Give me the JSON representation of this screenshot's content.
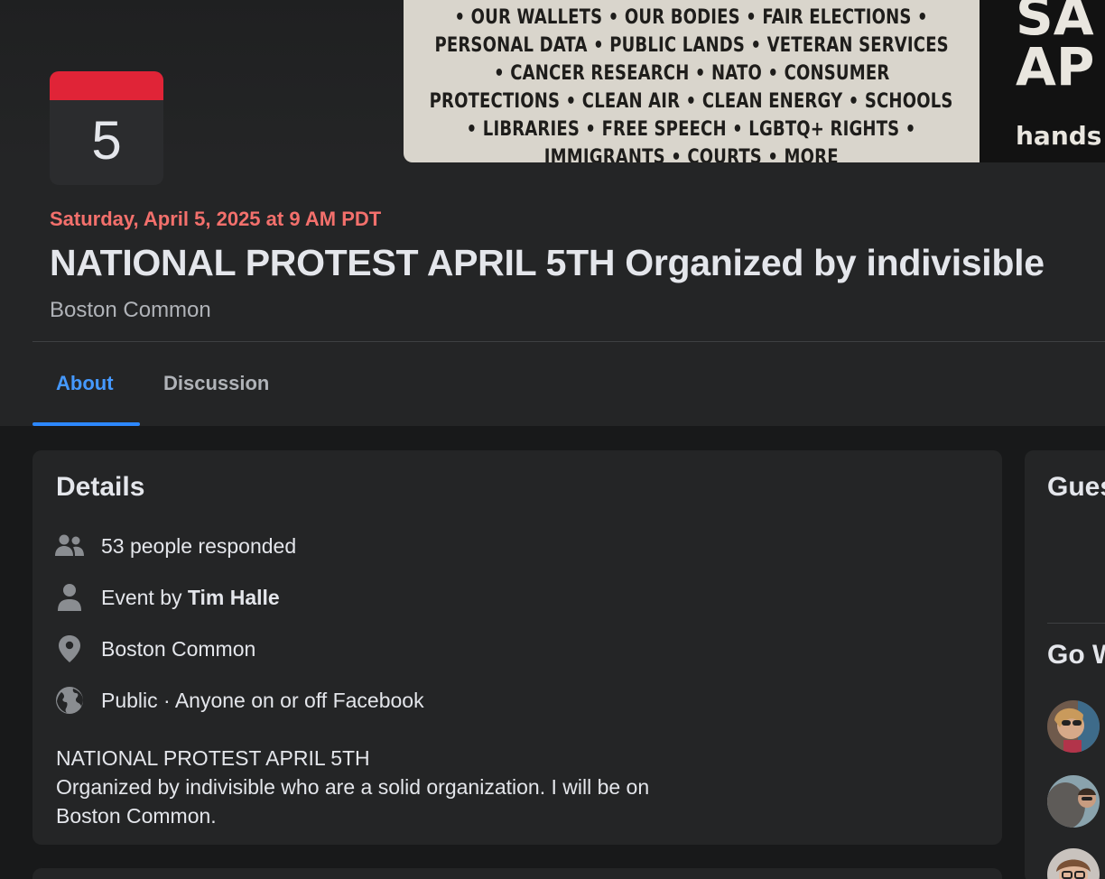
{
  "cover": {
    "lines": [
      "• OUR WALLETS • OUR BODIES • FAIR ELECTIONS •",
      "PERSONAL DATA • PUBLIC LANDS • VETERAN SERVICES",
      "• CANCER RESEARCH • NATO • CONSUMER",
      "PROTECTIONS • CLEAN AIR • CLEAN ENERGY • SCHOOLS",
      "• LIBRARIES • FREE SPEECH • LGBTQ+ RIGHTS •",
      "IMMIGRANTS • COURTS • MORE"
    ],
    "big_1": "SA",
    "big_2": "AP",
    "small": "hands"
  },
  "calendar": {
    "day": "5",
    "accent_color": "#e02437"
  },
  "event": {
    "date": "Saturday, April 5, 2025 at 9 AM PDT",
    "title": "NATIONAL PROTEST APRIL 5TH Organized by indivisible",
    "location": "Boston Common"
  },
  "tabs": [
    {
      "label": "About",
      "active": true
    },
    {
      "label": "Discussion",
      "active": false
    }
  ],
  "details": {
    "title": "Details",
    "responded": "53 people responded",
    "event_by_prefix": "Event by",
    "host": "Tim Halle",
    "place": "Boston Common",
    "privacy": "Public · Anyone on or off Facebook",
    "description_line1": "NATIONAL PROTEST APRIL 5TH",
    "description_line2": "Organized by indivisible who are a solid organization. I will be on Boston Common."
  },
  "sidebar": {
    "guests_title": "Gues",
    "going_title": "Go W"
  },
  "colors": {
    "date_red": "#f3706c",
    "tab_active_blue": "#4599ff",
    "background": "#18191a",
    "card": "#242526"
  }
}
